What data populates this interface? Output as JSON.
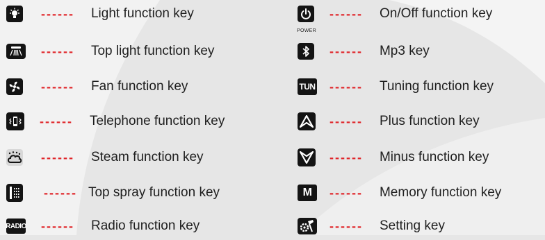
{
  "left_items": [
    {
      "dashes": "------",
      "label": "Light function key",
      "icon": "light-bulb-icon"
    },
    {
      "dashes": "------",
      "label": "Top light function key",
      "icon": "top-light-icon"
    },
    {
      "dashes": "------",
      "label": "Fan function key",
      "icon": "fan-icon"
    },
    {
      "dashes": "------",
      "label": "Telephone function key",
      "icon": "telephone-icon"
    },
    {
      "dashes": "------",
      "label": "Steam function key",
      "icon": "steam-icon"
    },
    {
      "dashes": "------",
      "label": "Top spray function key",
      "icon": "top-spray-icon"
    },
    {
      "dashes": "------",
      "label": "Radio function key",
      "icon": "radio-icon",
      "icon_text": "RADIO"
    }
  ],
  "right_items": [
    {
      "dashes": "------",
      "label": "On/Off function key",
      "icon": "power-icon",
      "caption": "POWER"
    },
    {
      "dashes": "------",
      "label": "Mp3 key",
      "icon": "bluetooth-icon"
    },
    {
      "dashes": "------",
      "label": "Tuning function key",
      "icon": "tuning-icon",
      "icon_text": "TUN"
    },
    {
      "dashes": "------",
      "label": "Plus function key",
      "icon": "plus-arrow-icon"
    },
    {
      "dashes": "------",
      "label": "Minus function key",
      "icon": "minus-arrow-icon"
    },
    {
      "dashes": "------",
      "label": "Memory function key",
      "icon": "memory-icon",
      "icon_text": "M"
    },
    {
      "dashes": "------",
      "label": "Setting key",
      "icon": "setting-icon"
    }
  ],
  "colors": {
    "dash": "#e0262a",
    "icon_bg": "#141414",
    "text": "#1f1f1f",
    "background": "#e6e6e6"
  }
}
